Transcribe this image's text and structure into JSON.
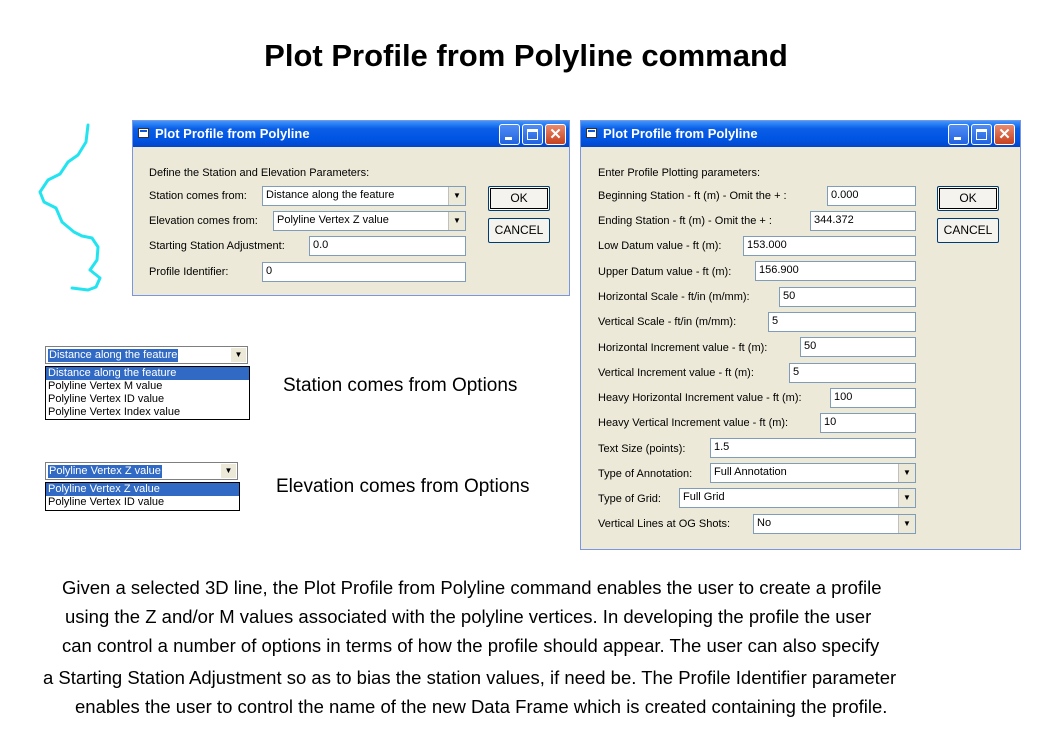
{
  "page": {
    "title": "Plot Profile from Polyline command"
  },
  "dialog1": {
    "title": "Plot Profile from Polyline",
    "heading": "Define the Station and Elevation Parameters:",
    "station_label": "Station comes from:",
    "station_value": "Distance along the feature",
    "elevation_label": "Elevation comes from:",
    "elevation_value": "Polyline Vertex Z value",
    "adjust_label": "Starting Station Adjustment:",
    "adjust_value": "0.0",
    "identifier_label": "Profile Identifier:",
    "identifier_value": "0",
    "ok": "OK",
    "cancel": "CANCEL"
  },
  "dialog2": {
    "title": "Plot Profile from Polyline",
    "heading": "Enter Profile Plotting parameters:",
    "rows": [
      {
        "label": "Beginning Station - ft (m) - Omit the + :",
        "value": "0.000"
      },
      {
        "label": "Ending Station - ft (m) - Omit the + :",
        "value": "344.372"
      },
      {
        "label": "Low Datum value - ft (m):",
        "value": "153.000"
      },
      {
        "label": "Upper Datum value - ft (m):",
        "value": "156.900"
      },
      {
        "label": "Horizontal Scale - ft/in (m/mm):",
        "value": "50"
      },
      {
        "label": "Vertical Scale - ft/in (m/mm):",
        "value": "5"
      },
      {
        "label": "Horizontal Increment value - ft (m):",
        "value": "50"
      },
      {
        "label": "Vertical Increment value - ft (m):",
        "value": "5"
      },
      {
        "label": "Heavy Horizontal Increment value - ft (m):",
        "value": "100"
      },
      {
        "label": "Heavy Vertical Increment value - ft (m):",
        "value": "10"
      },
      {
        "label": "Text Size (points):",
        "value": "1.5"
      },
      {
        "label": "Type of Annotation:",
        "value": "Full Annotation"
      },
      {
        "label": "Type of Grid:",
        "value": "Full Grid"
      },
      {
        "label": "Vertical Lines at OG Shots:",
        "value": "No"
      }
    ],
    "ok": "OK",
    "cancel": "CANCEL"
  },
  "station_options": {
    "selected": "Distance along the feature",
    "items": [
      "Distance along the feature",
      "Polyline Vertex M value",
      "Polyline Vertex ID value",
      "Polyline Vertex Index value"
    ],
    "caption": "Station comes from Options"
  },
  "elevation_options": {
    "selected": "Polyline Vertex Z value",
    "items": [
      "Polyline Vertex Z value",
      "Polyline Vertex ID value"
    ],
    "caption": "Elevation comes from Options"
  },
  "description": [
    "Given a selected 3D line, the Plot Profile from Polyline command enables the user to create a profile",
    "using the Z and/or M values associated with the polyline vertices.  In developing the profile the user",
    "can control a number of options in terms of how the profile should appear. The user can also specify",
    "a Starting Station Adjustment so as to bias the station values, if need be. The Profile Identifier parameter",
    "enables the user to control the name of the new Data Frame which is created containing the profile."
  ],
  "colors": {
    "polyline": "#22e4f0",
    "titlebar": "#0054e3",
    "selection": "#316ac5"
  }
}
